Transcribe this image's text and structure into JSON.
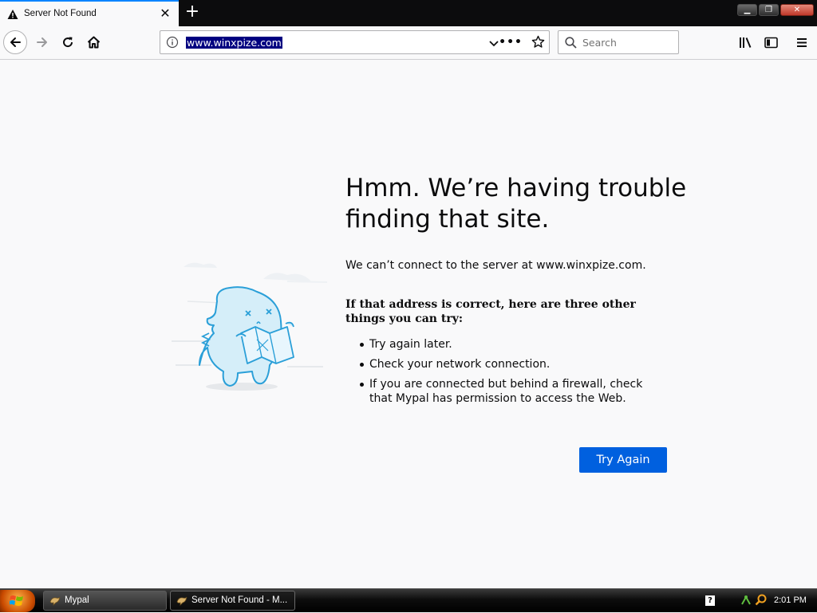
{
  "browser": {
    "tab": {
      "title": "Server Not Found",
      "close_glyph": "✕"
    },
    "new_tab_glyph": "+",
    "window_controls": {
      "minimize": "▁",
      "maximize": "❐",
      "close": "✕"
    },
    "url": "www.winxpize.com",
    "more_glyph": "•••",
    "search": {
      "placeholder": "Search"
    },
    "icons": {
      "back": "back-arrow-icon",
      "forward": "forward-arrow-icon",
      "reload": "reload-icon",
      "home": "home-icon",
      "info": "info-icon",
      "library": "library-icon",
      "sidebar": "sidebar-icon",
      "menu": "hamburger-menu-icon"
    }
  },
  "error_page": {
    "title": "Hmm. We’re having trouble finding that site.",
    "short_desc": "We can’t connect to the server at www.winxpize.com.",
    "try_heading": "If that address is correct, here are three other things you can try:",
    "tips": [
      "Try again later.",
      "Check your network connection.",
      "If you are connected but behind a firewall, check that Mypal has permission to access the Web."
    ],
    "try_again_label": "Try Again",
    "accent_color": "#0060df"
  },
  "taskbar": {
    "tasks": [
      {
        "label": "Mypal"
      },
      {
        "label": "Server Not Found - M..."
      }
    ],
    "clock": "2:01 PM",
    "help_glyph": "?"
  }
}
